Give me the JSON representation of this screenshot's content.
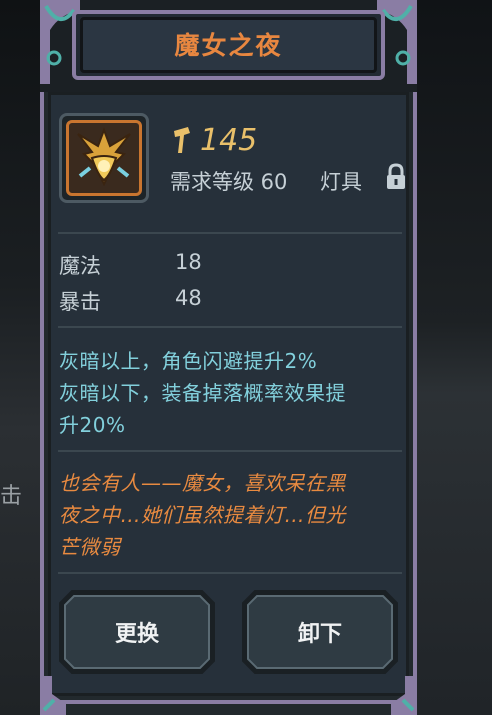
{
  "background": {
    "left_partial_text": "击"
  },
  "dialog": {
    "title": "魔女之夜",
    "item": {
      "icon": "gold-flower-lantern-icon",
      "score_icon": "hammer-icon",
      "score": "145",
      "required_level": "需求等级 60",
      "type": "灯具",
      "locked": true
    },
    "stats": [
      {
        "name": "魔法",
        "value": "18"
      },
      {
        "name": "暴击",
        "value": "48"
      }
    ],
    "effect_lines": [
      "灰暗以上，角色闪避提升2%",
      "灰暗以下，装备掉落概率效果提",
      "升20%"
    ],
    "flavor_lines": [
      "也会有人——魔女，喜欢呆在黑",
      "夜之中…她们虽然提着灯…但光",
      "芒微弱"
    ],
    "buttons": {
      "replace": "更换",
      "unequip": "卸下"
    }
  },
  "colors": {
    "title": "#e88740",
    "score": "#e9c06a",
    "effect": "#82d0dc",
    "flavor": "#e88a40",
    "frame": "#8a7da4"
  }
}
